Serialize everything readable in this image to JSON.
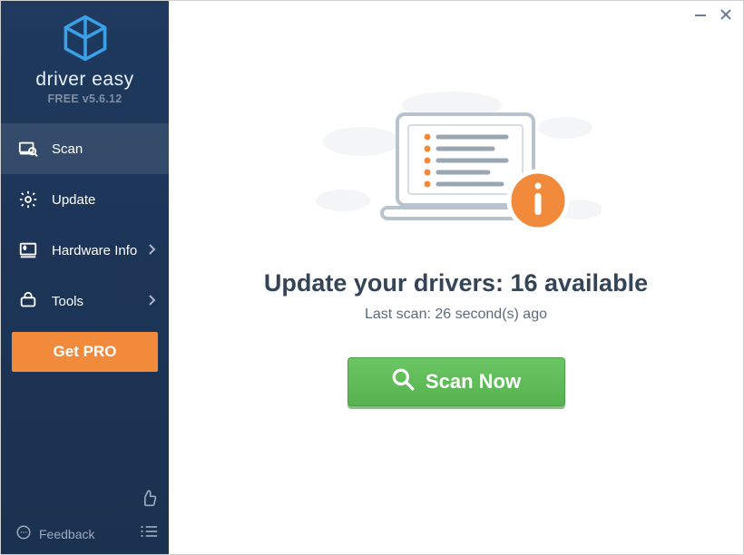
{
  "brand": {
    "name": "driver easy",
    "version_label": "FREE v5.6.12"
  },
  "sidebar": {
    "items": [
      {
        "label": "Scan"
      },
      {
        "label": "Update"
      },
      {
        "label": "Hardware Info"
      },
      {
        "label": "Tools"
      }
    ],
    "get_pro_label": "Get PRO",
    "feedback_label": "Feedback"
  },
  "main": {
    "headline": "Update your drivers: 16 available",
    "subline": "Last scan: 26 second(s) ago",
    "scan_button_label": "Scan Now"
  },
  "colors": {
    "accent_orange": "#f18a3a",
    "scan_green": "#5fbf58",
    "sidebar_bg": "#1d3558",
    "text_dark": "#344558"
  }
}
